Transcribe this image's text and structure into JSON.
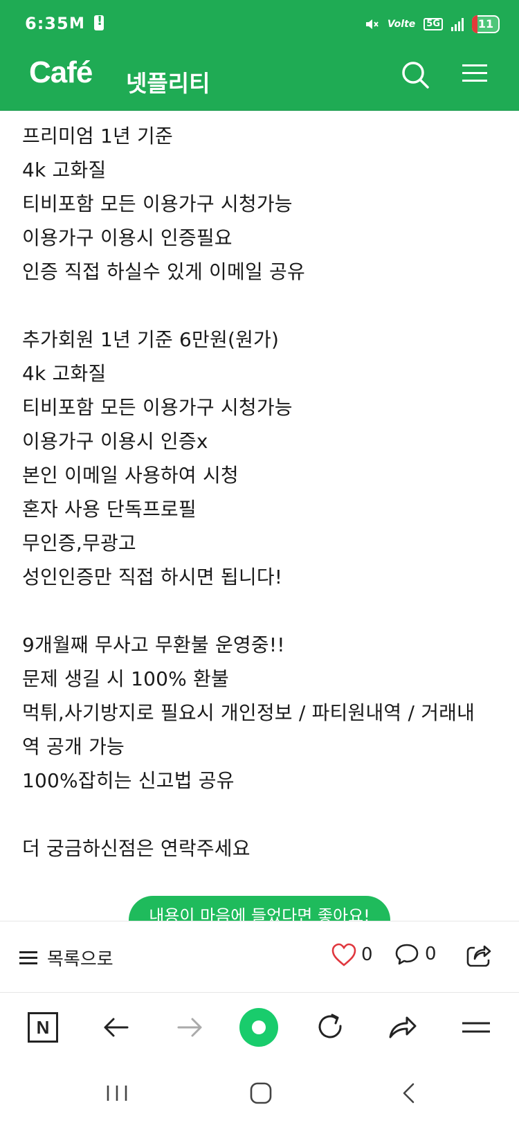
{
  "status_bar": {
    "time": "6:35",
    "gmail_icon": "M",
    "network": "Volte",
    "network_5g": "5G",
    "battery": "11"
  },
  "header": {
    "logo": "Café",
    "cafe_name": "넷플리티"
  },
  "post": {
    "lines": [
      "프리미엄 1년 기준",
      "4k 고화질",
      "티비포함 모든 이용가구 시청가능",
      "이용가구 이용시 인증필요",
      "인증 직접 하실수 있게 이메일 공유",
      "",
      "추가회원 1년 기준 6만원(원가)",
      "4k 고화질",
      "티비포함 모든 이용가구 시청가능",
      "이용가구 이용시 인증x",
      "본인 이메일 사용하여 시청",
      "혼자 사용 단독프로필",
      "무인증,무광고",
      "성인인증만 직접 하시면 됩니다!",
      "",
      "9개월째 무사고 무환불 운영중!!",
      "문제 생길 시 100% 환불",
      "먹튀,사기방지로 필요시 개인정보 / 파티원내역 / 거래내",
      "역 공개 가능",
      "100%잡히는 신고법 공유",
      "",
      "더 궁금하신점은 연락주세요"
    ],
    "like_banner": "내용이 마음에 들었다면 좋아요!"
  },
  "actions": {
    "list_label": "목록으로",
    "like_count": "0",
    "comment_count": "0"
  },
  "browser_toolbar": {
    "home_label": "N"
  },
  "colors": {
    "brand_green": "#1fab54",
    "like_red": "#e0373e",
    "accent_green": "#19cc6c"
  }
}
